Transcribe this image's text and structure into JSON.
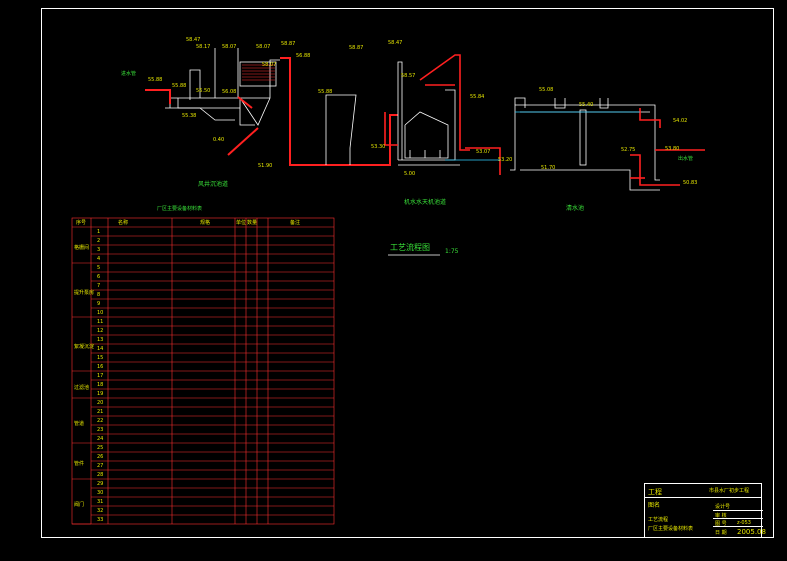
{
  "drawing": {
    "section_labels": {
      "grit_chamber": "风井沉池道",
      "clarifier": "机水水天机池道",
      "clear_water_tank": "清水池"
    },
    "process_title": "工艺流程图",
    "scale": "1:75",
    "elevations": {
      "e1": "58.47",
      "e2": "58.17",
      "e3": "58.07",
      "e4": "58.07",
      "e5": "58.87",
      "e6": "56.88",
      "e7": "58.07",
      "e8": "58.87",
      "e9": "58.47",
      "e10": "58.57",
      "e11": "55.88",
      "e12": "55.88",
      "e13": "56.50",
      "e14": "56.08",
      "e15": "55.88",
      "e16": "55.38",
      "e17": "55.84",
      "e18": "51.90",
      "e19": "53.30",
      "e20": "53.07",
      "e21": "53.20",
      "e22": "55.08",
      "e23": "55.40",
      "e24": "54.02",
      "e25": "52.75",
      "e26": "53.80",
      "e27": "51.70",
      "e28": "50.83",
      "e29": "5.00",
      "e30": "0.40"
    },
    "small_labels": {
      "inlet": "进水管",
      "outlet": "出水管"
    }
  },
  "table": {
    "caption": "厂区主要设备材料表",
    "headers": [
      "序号",
      "名称",
      "规格",
      "单位",
      "数量",
      "备注"
    ],
    "groups": [
      "格栅间",
      "提升泵房",
      "絮凝沉淀",
      "过滤池",
      "管道",
      "管件",
      "阀门"
    ],
    "row_numbers": [
      "1",
      "2",
      "3",
      "4",
      "5",
      "6",
      "7",
      "8",
      "9",
      "10",
      "11",
      "12",
      "13",
      "14",
      "15",
      "16",
      "17",
      "18",
      "19",
      "20",
      "21",
      "22",
      "23",
      "24",
      "25",
      "26",
      "27",
      "28",
      "29",
      "30",
      "31",
      "32",
      "33"
    ]
  },
  "title_block": {
    "project": "工程",
    "company": "市县水厂初步工程",
    "drawing_name": "图名",
    "sub1": "工艺流程",
    "sub2": "厂区主要设备材料表",
    "label_design": "设计号",
    "label_check": "审 核",
    "label_no": "图 号",
    "label_date": "日 期",
    "drawing_no": "z-053",
    "date": "2005.08"
  }
}
